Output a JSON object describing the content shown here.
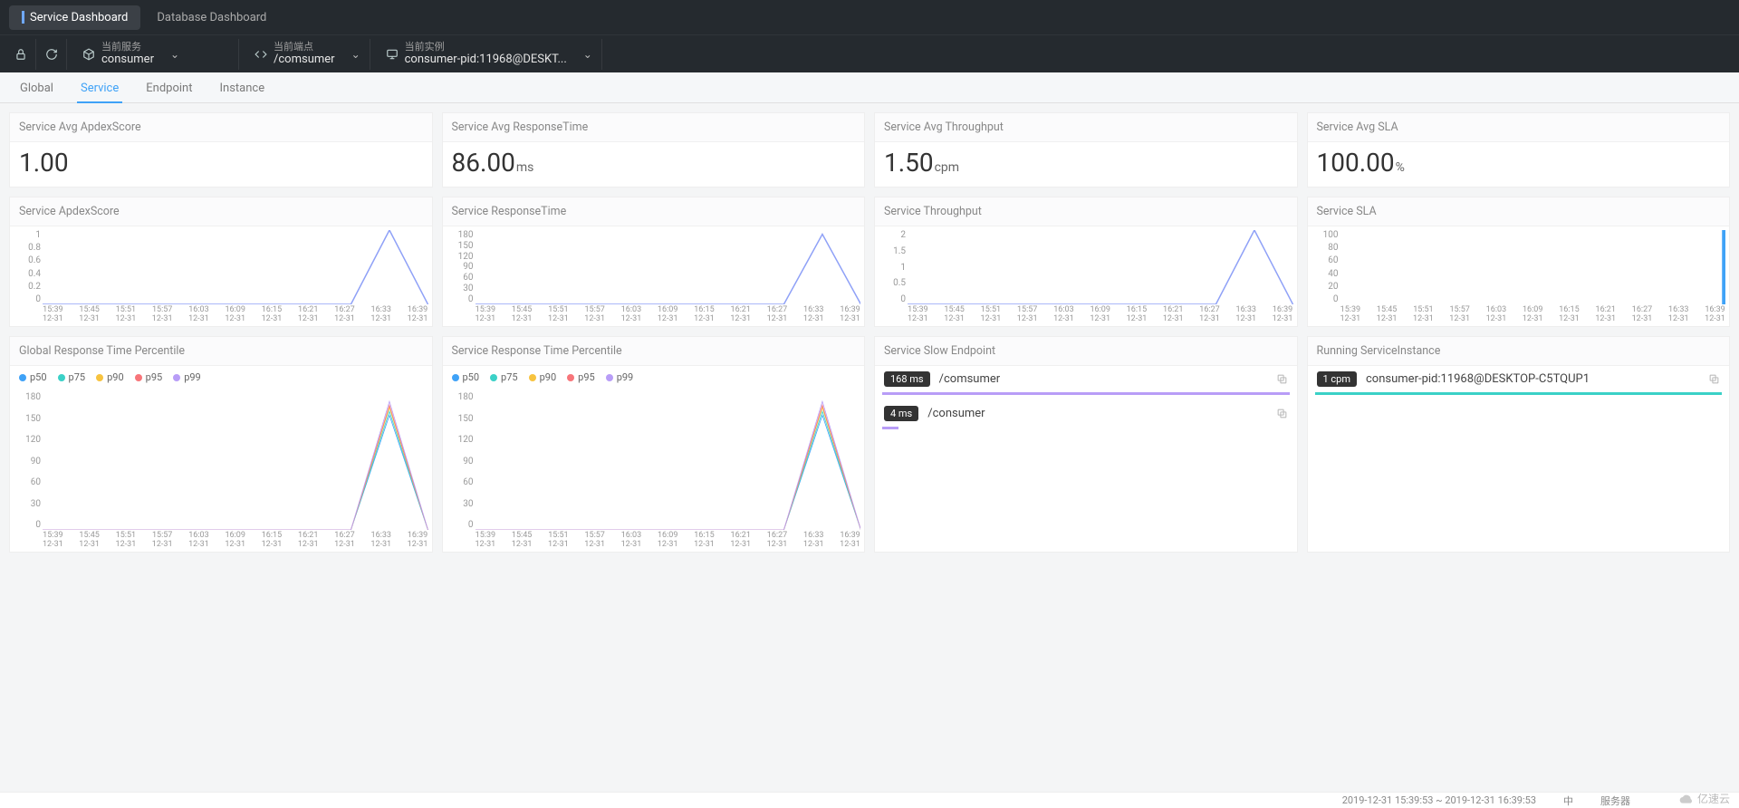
{
  "topTabs": {
    "service": "Service Dashboard",
    "database": "Database Dashboard"
  },
  "toolbar": {
    "currentService": {
      "label": "当前服务",
      "value": "consumer"
    },
    "currentEndpoint": {
      "label": "当前端点",
      "value": "/comsumer"
    },
    "currentInstance": {
      "label": "当前实例",
      "value": "consumer-pid:11968@DESKT..."
    }
  },
  "subTabs": {
    "global": "Global",
    "service": "Service",
    "endpoint": "Endpoint",
    "instance": "Instance"
  },
  "summary": {
    "apdex": {
      "title": "Service Avg ApdexScore",
      "value": "1.00",
      "unit": ""
    },
    "response": {
      "title": "Service Avg ResponseTime",
      "value": "86.00",
      "unit": "ms"
    },
    "throughput": {
      "title": "Service Avg Throughput",
      "value": "1.50",
      "unit": "cpm"
    },
    "sla": {
      "title": "Service Avg SLA",
      "value": "100.00",
      "unit": "%"
    }
  },
  "charts": {
    "apdex": {
      "title": "Service ApdexScore"
    },
    "response": {
      "title": "Service ResponseTime"
    },
    "throughput": {
      "title": "Service Throughput"
    },
    "sla": {
      "title": "Service SLA"
    },
    "globalPercentile": {
      "title": "Global Response Time Percentile"
    },
    "servicePercentile": {
      "title": "Service Response Time Percentile"
    },
    "slowEndpoint": {
      "title": "Service Slow Endpoint"
    },
    "runningInstance": {
      "title": "Running ServiceInstance"
    }
  },
  "percentileLegend": {
    "p50": "p50",
    "p75": "p75",
    "p90": "p90",
    "p95": "p95",
    "p99": "p99"
  },
  "legendColors": {
    "p50": "#3fa2f7",
    "p75": "#3bd1c7",
    "p90": "#f7c33f",
    "p95": "#f7757a",
    "p99": "#b89df7"
  },
  "slowEndpoints": [
    {
      "badge": "168 ms",
      "name": "/comsumer",
      "progress": 100,
      "color": "#b89df7"
    },
    {
      "badge": "4 ms",
      "name": "/consumer",
      "progress": 4,
      "color": "#b89df7"
    }
  ],
  "runningInstances": [
    {
      "badge": "1 cpm",
      "name": "consumer-pid:11968@DESKTOP-C5TQUP1",
      "progress": 100,
      "color": "#3bd1c7"
    }
  ],
  "footer": {
    "range": "2019-12-31 15:39:53 ~ 2019-12-31 16:39:53",
    "lang": "中",
    "server": "服务器",
    "brand": "亿速云"
  },
  "chart_data": [
    {
      "type": "line",
      "title": "Service ApdexScore",
      "x": [
        "15:39",
        "15:45",
        "15:51",
        "15:57",
        "16:03",
        "16:09",
        "16:15",
        "16:21",
        "16:27",
        "16:33",
        "16:39"
      ],
      "x_date": "12-31",
      "y_ticks": [
        0,
        0.2,
        0.4,
        0.6,
        0.8,
        1
      ],
      "values": [
        0,
        0,
        0,
        0,
        0,
        0,
        0,
        0,
        0,
        1,
        0
      ],
      "ylim": [
        0,
        1
      ]
    },
    {
      "type": "line",
      "title": "Service ResponseTime",
      "x": [
        "15:39",
        "15:45",
        "15:51",
        "15:57",
        "16:03",
        "16:09",
        "16:15",
        "16:21",
        "16:27",
        "16:33",
        "16:39"
      ],
      "x_date": "12-31",
      "y_ticks": [
        0,
        30,
        60,
        90,
        120,
        150,
        180
      ],
      "values": [
        0,
        0,
        0,
        0,
        0,
        0,
        0,
        0,
        0,
        170,
        0
      ],
      "ylim": [
        0,
        180
      ]
    },
    {
      "type": "line",
      "title": "Service Throughput",
      "x": [
        "15:39",
        "15:45",
        "15:51",
        "15:57",
        "16:03",
        "16:09",
        "16:15",
        "16:21",
        "16:27",
        "16:33",
        "16:39"
      ],
      "x_date": "12-31",
      "y_ticks": [
        0,
        0.5,
        1,
        1.5,
        2
      ],
      "values": [
        0,
        0,
        0,
        0,
        0,
        0,
        0,
        0,
        0,
        2,
        0
      ],
      "ylim": [
        0,
        2
      ]
    },
    {
      "type": "bar",
      "title": "Service SLA",
      "x": [
        "15:39",
        "15:45",
        "15:51",
        "15:57",
        "16:03",
        "16:09",
        "16:15",
        "16:21",
        "16:27",
        "16:33",
        "16:39"
      ],
      "x_date": "12-31",
      "y_ticks": [
        0,
        20,
        40,
        60,
        80,
        100
      ],
      "values": [
        0,
        0,
        0,
        0,
        0,
        0,
        0,
        0,
        0,
        0,
        100
      ],
      "ylim": [
        0,
        100
      ]
    },
    {
      "type": "line",
      "title": "Global Response Time Percentile",
      "x": [
        "15:39",
        "15:45",
        "15:51",
        "15:57",
        "16:03",
        "16:09",
        "16:15",
        "16:21",
        "16:27",
        "16:33",
        "16:39"
      ],
      "x_date": "12-31",
      "y_ticks": [
        0,
        30,
        60,
        90,
        120,
        150,
        180
      ],
      "series": [
        {
          "name": "p50",
          "values": [
            0,
            0,
            0,
            0,
            0,
            0,
            0,
            0,
            0,
            150,
            0
          ]
        },
        {
          "name": "p75",
          "values": [
            0,
            0,
            0,
            0,
            0,
            0,
            0,
            0,
            0,
            155,
            0
          ]
        },
        {
          "name": "p90",
          "values": [
            0,
            0,
            0,
            0,
            0,
            0,
            0,
            0,
            0,
            160,
            0
          ]
        },
        {
          "name": "p95",
          "values": [
            0,
            0,
            0,
            0,
            0,
            0,
            0,
            0,
            0,
            163,
            0
          ]
        },
        {
          "name": "p99",
          "values": [
            0,
            0,
            0,
            0,
            0,
            0,
            0,
            0,
            0,
            168,
            0
          ]
        }
      ],
      "ylim": [
        0,
        180
      ]
    },
    {
      "type": "line",
      "title": "Service Response Time Percentile",
      "x": [
        "15:39",
        "15:45",
        "15:51",
        "15:57",
        "16:03",
        "16:09",
        "16:15",
        "16:21",
        "16:27",
        "16:33",
        "16:39"
      ],
      "x_date": "12-31",
      "y_ticks": [
        0,
        30,
        60,
        90,
        120,
        150,
        180
      ],
      "series": [
        {
          "name": "p50",
          "values": [
            0,
            0,
            0,
            0,
            0,
            0,
            0,
            0,
            0,
            150,
            0
          ]
        },
        {
          "name": "p75",
          "values": [
            0,
            0,
            0,
            0,
            0,
            0,
            0,
            0,
            0,
            155,
            0
          ]
        },
        {
          "name": "p90",
          "values": [
            0,
            0,
            0,
            0,
            0,
            0,
            0,
            0,
            0,
            160,
            0
          ]
        },
        {
          "name": "p95",
          "values": [
            0,
            0,
            0,
            0,
            0,
            0,
            0,
            0,
            0,
            163,
            0
          ]
        },
        {
          "name": "p99",
          "values": [
            0,
            0,
            0,
            0,
            0,
            0,
            0,
            0,
            0,
            168,
            0
          ]
        }
      ],
      "ylim": [
        0,
        180
      ]
    }
  ]
}
